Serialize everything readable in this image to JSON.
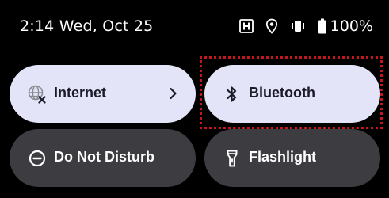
{
  "status_bar": {
    "datetime": "2:14 Wed, Oct 25",
    "battery_percent": "100%",
    "icons": [
      "nfc-icon",
      "location-icon",
      "vibrate-icon",
      "battery-icon"
    ]
  },
  "quick_settings": {
    "tiles": [
      {
        "label": "Internet",
        "icon": "globe-icon",
        "state": "active",
        "has_chevron": true
      },
      {
        "label": "Bluetooth",
        "icon": "bluetooth-icon",
        "state": "active"
      },
      {
        "label": "Do Not Disturb",
        "icon": "do-not-disturb-icon",
        "state": "inactive"
      },
      {
        "label": "Flashlight",
        "icon": "flashlight-icon",
        "state": "inactive"
      }
    ]
  },
  "colors": {
    "background": "#000000",
    "tile_active": "#e4e4f8",
    "tile_inactive": "#3d3d41",
    "highlight": "#c4161c"
  }
}
